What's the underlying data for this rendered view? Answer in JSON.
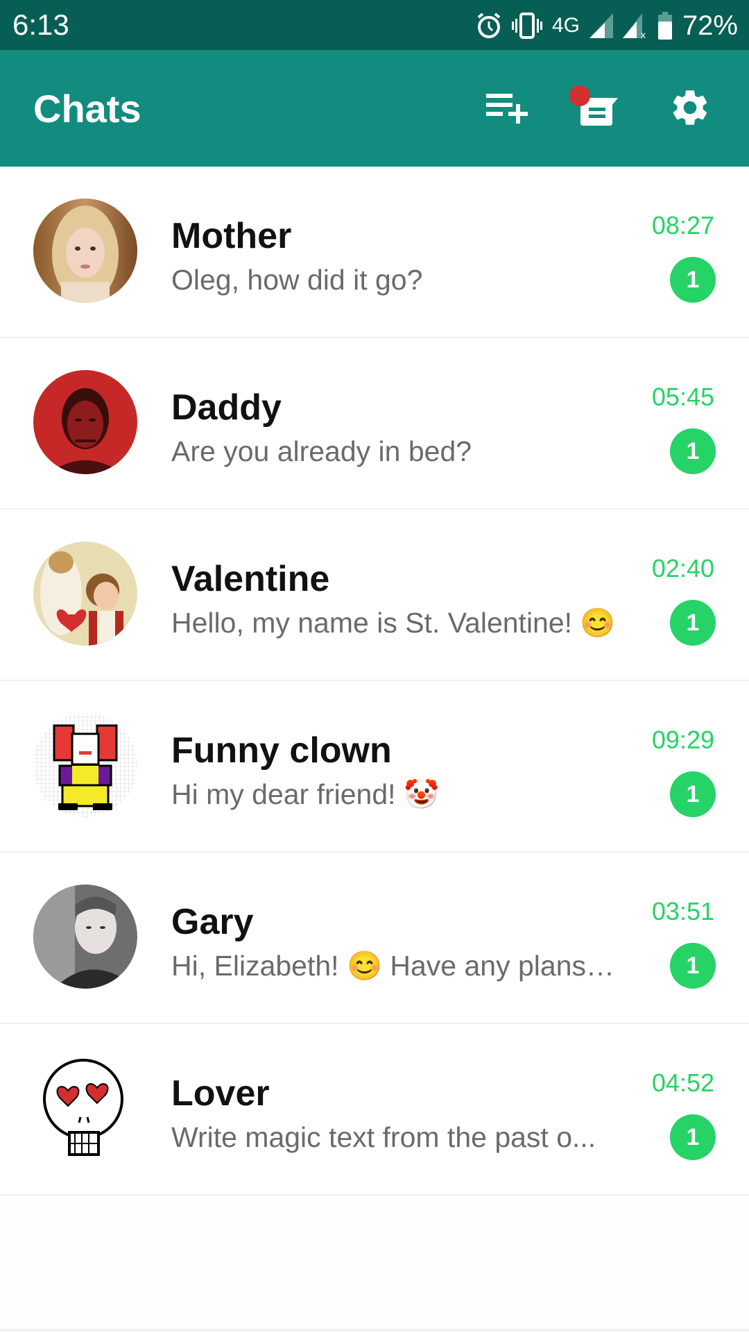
{
  "status_bar": {
    "time": "6:13",
    "network": "4G",
    "battery": "72%",
    "icons": [
      "alarm-icon",
      "vibrate-icon",
      "signal-icon",
      "signal-no-data-icon",
      "battery-icon"
    ]
  },
  "app_bar": {
    "title": "Chats",
    "actions": [
      {
        "name": "new-broadcast-icon"
      },
      {
        "name": "messages-icon",
        "has_notification_dot": true
      },
      {
        "name": "gear-icon"
      }
    ],
    "colors": {
      "status_bar": "#075e54",
      "app_bar": "#128c7e",
      "accent": "#25d366",
      "notification_dot": "#d32f2f"
    }
  },
  "chats": [
    {
      "name": "Mother",
      "message": "Oleg, how did it go?",
      "time": "08:27",
      "unread": "1",
      "avatar": "photo-woman"
    },
    {
      "name": "Daddy",
      "message": "Are you already in bed?",
      "time": "05:45",
      "unread": "1",
      "avatar": "photo-man-red"
    },
    {
      "name": "Valentine",
      "message": "Hello, my name is St. Valentine! 😊",
      "time": "02:40",
      "unread": "1",
      "avatar": "vintage-valentine-card"
    },
    {
      "name": "Funny clown",
      "message": "Hi my dear friend! 🤡",
      "time": "09:29",
      "unread": "1",
      "avatar": "pixel-clown"
    },
    {
      "name": "Gary",
      "message": "Hi, Elizabeth! 😊 Have any plans t...",
      "time": "03:51",
      "unread": "1",
      "avatar": "photo-young-man-bw"
    },
    {
      "name": "Lover",
      "message": "Write magic text from the past o...",
      "time": "04:52",
      "unread": "1",
      "avatar": "skull-heart-eyes"
    }
  ]
}
